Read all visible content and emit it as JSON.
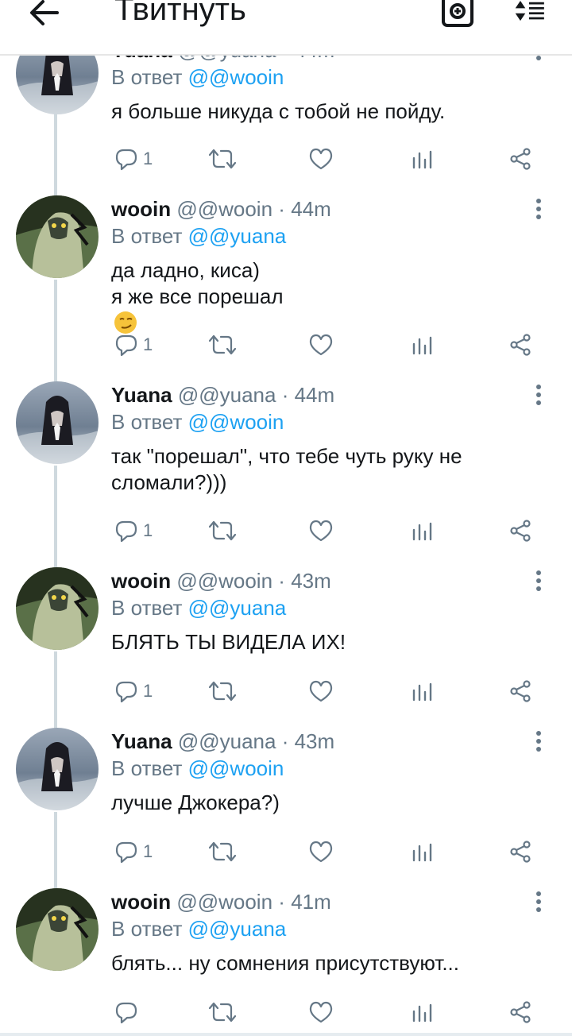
{
  "header": {
    "title": "Твитнуть",
    "back_icon": "arrow-left-icon",
    "camera_icon": "add-photo-icon",
    "sort_icon": "sort-list-icon"
  },
  "colors": {
    "link": "#1da1f2",
    "muted": "#657786",
    "text": "#14171a"
  },
  "tweets": [
    {
      "name": "Yuana",
      "handle": "@@yuana",
      "time": "44m",
      "reply_prefix": "В ответ",
      "reply_to": "@@wooin",
      "lines": [
        "я больше никуда с тобой не пойду."
      ],
      "emoji": "",
      "reply_count": "1",
      "avatar": "yuana"
    },
    {
      "name": "wooin",
      "handle": "@@wooin",
      "time": "44m",
      "reply_prefix": "В ответ",
      "reply_to": "@@yuana",
      "lines": [
        "да ладно, киса)",
        "я же все порешал"
      ],
      "emoji": "smirk-emoji",
      "reply_count": "1",
      "avatar": "wooin"
    },
    {
      "name": "Yuana",
      "handle": "@@yuana",
      "time": "44m",
      "reply_prefix": "В ответ",
      "reply_to": "@@wooin",
      "lines": [
        "так \"порешал\", что тебе чуть руку не",
        "сломали?)))"
      ],
      "emoji": "",
      "reply_count": "1",
      "avatar": "yuana"
    },
    {
      "name": "wooin",
      "handle": "@@wooin",
      "time": "43m",
      "reply_prefix": "В ответ",
      "reply_to": "@@yuana",
      "lines": [
        "БЛЯТЬ ТЫ ВИДЕЛА ИХ!"
      ],
      "emoji": "",
      "reply_count": "1",
      "avatar": "wooin"
    },
    {
      "name": "Yuana",
      "handle": "@@yuana",
      "time": "43m",
      "reply_prefix": "В ответ",
      "reply_to": "@@wooin",
      "lines": [
        "лучше Джокера?)"
      ],
      "emoji": "",
      "reply_count": "1",
      "avatar": "yuana"
    },
    {
      "name": "wooin",
      "handle": "@@wooin",
      "time": "41m",
      "reply_prefix": "В ответ",
      "reply_to": "@@yuana",
      "lines": [
        "блять... ну сомнения присутствуют..."
      ],
      "emoji": "",
      "reply_count": "",
      "avatar": "wooin"
    }
  ]
}
